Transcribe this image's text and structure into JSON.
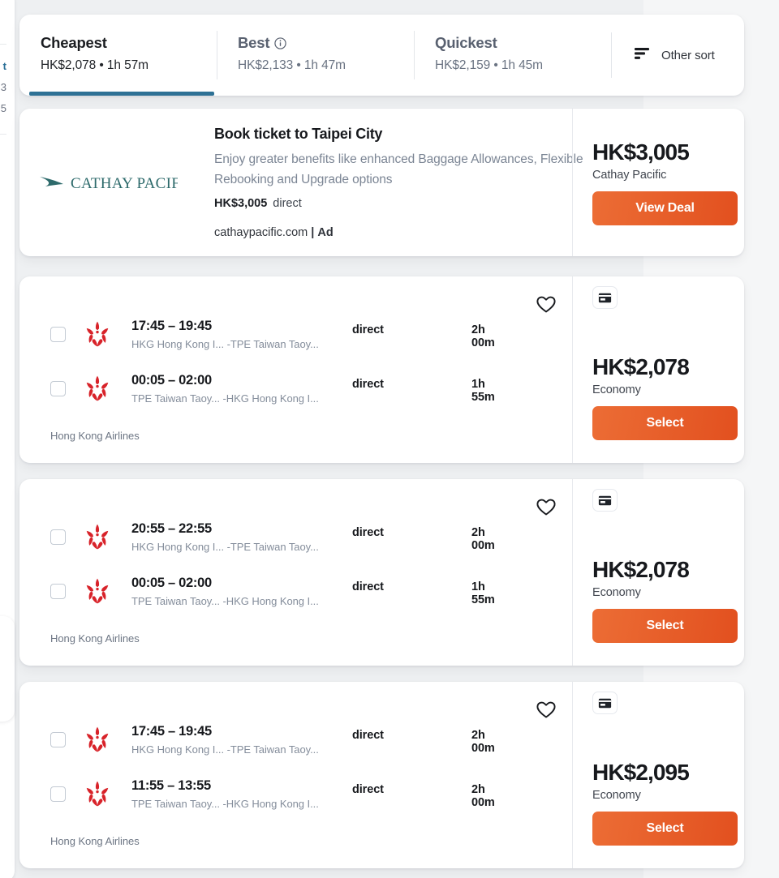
{
  "sort_bar": {
    "tabs": [
      {
        "id": "cheapest",
        "label": "Cheapest",
        "sub": "HK$2,078 • 1h 57m",
        "active": true,
        "has_info_icon": false
      },
      {
        "id": "best",
        "label": "Best",
        "sub": "HK$2,133 • 1h 47m",
        "active": false,
        "has_info_icon": true
      },
      {
        "id": "quickest",
        "label": "Quickest",
        "sub": "HK$2,159 • 1h 45m",
        "active": false,
        "has_info_icon": false
      }
    ],
    "other_sort_label": "Other sort",
    "active_underline_color": "#2e7195"
  },
  "ad": {
    "airline_logo_text": "CATHAY PACIFIC",
    "logo_color": "#2d6a6b",
    "title": "Book ticket to Taipei City",
    "description": "Enjoy greater benefits like enhanced Baggage Allowances, Flexible Rebooking and Upgrade options",
    "inline_price": "HK$3,005",
    "inline_stops": "direct",
    "url": "cathaypacific.com",
    "url_separator": "|",
    "ad_label": "Ad",
    "price": "HK$3,005",
    "provider": "Cathay Pacific",
    "cta_label": "View Deal"
  },
  "accent": {
    "cta_gradient_start": "#ec6d35",
    "cta_gradient_end": "#e2501f",
    "airline_logo_red": "#d8232a"
  },
  "flights": [
    {
      "id": "flight-1",
      "price": "HK$2,078",
      "cabin": "Economy",
      "cta_label": "Select",
      "airline": "Hong Kong Airlines",
      "legs": [
        {
          "time": "17:45 – 19:45",
          "from_code": "HKG",
          "from_name": "Hong Kong I...",
          "to_code": "TPE",
          "to_name": "Taiwan Taoy...",
          "stops": "direct",
          "duration": "2h 00m"
        },
        {
          "time": "00:05 – 02:00",
          "from_code": "TPE",
          "from_name": "Taiwan Taoy...",
          "to_code": "HKG",
          "to_name": "Hong Kong I...",
          "stops": "direct",
          "duration": "1h 55m"
        }
      ]
    },
    {
      "id": "flight-2",
      "price": "HK$2,078",
      "cabin": "Economy",
      "cta_label": "Select",
      "airline": "Hong Kong Airlines",
      "legs": [
        {
          "time": "20:55 – 22:55",
          "from_code": "HKG",
          "from_name": "Hong Kong I...",
          "to_code": "TPE",
          "to_name": "Taiwan Taoy...",
          "stops": "direct",
          "duration": "2h 00m"
        },
        {
          "time": "00:05 – 02:00",
          "from_code": "TPE",
          "from_name": "Taiwan Taoy...",
          "to_code": "HKG",
          "to_name": "Hong Kong I...",
          "stops": "direct",
          "duration": "1h 55m"
        }
      ]
    },
    {
      "id": "flight-3",
      "price": "HK$2,095",
      "cabin": "Economy",
      "cta_label": "Select",
      "airline": "Hong Kong Airlines",
      "legs": [
        {
          "time": "17:45 – 19:45",
          "from_code": "HKG",
          "from_name": "Hong Kong I...",
          "to_code": "TPE",
          "to_name": "Taiwan Taoy...",
          "stops": "direct",
          "duration": "2h 00m"
        },
        {
          "time": "11:55 – 13:55",
          "from_code": "TPE",
          "from_name": "Taiwan Taoy...",
          "to_code": "HKG",
          "to_name": "Hong Kong I...",
          "stops": "direct",
          "duration": "2h 00m"
        }
      ]
    }
  ],
  "sidebar_sliver": {
    "rows": [
      "t",
      "3",
      "5"
    ]
  }
}
